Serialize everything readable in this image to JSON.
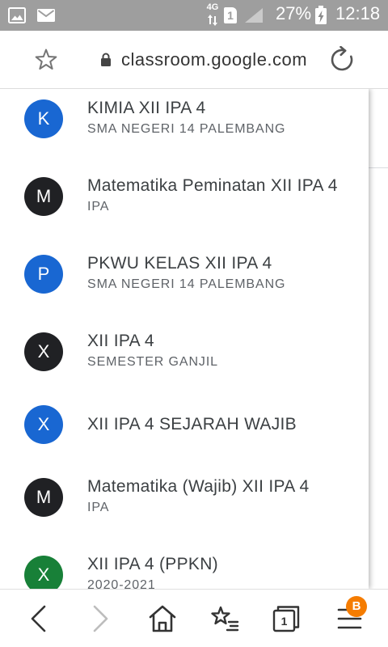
{
  "status_bar": {
    "network_type": "4G",
    "sim_slot": "1",
    "battery_level": "27%",
    "time": "12:18",
    "icons": [
      "image-icon",
      "mail-icon",
      "signal-icon",
      "battery-charging-icon"
    ]
  },
  "address_bar": {
    "url": "classroom.google.com",
    "icons": [
      "star-icon",
      "lock-icon",
      "reload-icon"
    ]
  },
  "classes": [
    {
      "initial": "K",
      "title": "KIMIA XII IPA 4",
      "subtitle": "SMA NEGERI 14 PALEMBANG",
      "avatar_color": "#1967d2"
    },
    {
      "initial": "M",
      "title": "Matematika Peminatan XII IPA 4",
      "subtitle": "IPA",
      "avatar_color": "#202124"
    },
    {
      "initial": "P",
      "title": "PKWU KELAS XII IPA 4",
      "subtitle": "SMA NEGERI 14 PALEMBANG",
      "avatar_color": "#1967d2"
    },
    {
      "initial": "X",
      "title": "XII IPA 4",
      "subtitle": "SEMESTER GANJIL",
      "avatar_color": "#202124"
    },
    {
      "initial": "X",
      "title": "XII IPA 4 SEJARAH WAJIB",
      "avatar_color": "#1967d2"
    },
    {
      "initial": "M",
      "title": "Matematika (Wajib) XII IPA 4",
      "subtitle": "IPA",
      "avatar_color": "#202124"
    },
    {
      "initial": "X",
      "title": "XII IPA 4 (PPKN)",
      "subtitle": "2020-2021",
      "avatar_color": "#188038"
    }
  ],
  "bottom_nav": {
    "forward_enabled": false,
    "tab_count": "1",
    "menu_badge": "B",
    "badge_color": "#f57c00",
    "icons": [
      "back-icon",
      "forward-icon",
      "home-icon",
      "bookmarks-icon",
      "tabs-icon",
      "menu-icon"
    ]
  }
}
